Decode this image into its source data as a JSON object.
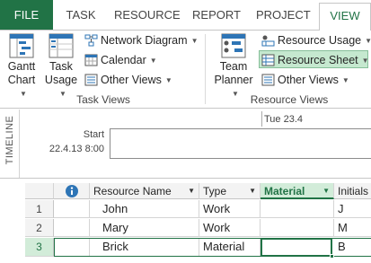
{
  "ribbon": {
    "tabs": {
      "file": "FILE",
      "task": "TASK",
      "resource": "RESOURCE",
      "report": "REPORT",
      "project": "PROJECT",
      "view": "VIEW"
    },
    "active_tab": "VIEW",
    "task_views": {
      "group_label": "Task Views",
      "gantt_chart": {
        "line1": "Gantt",
        "line2": "Chart",
        "icon": "gantt-chart-icon"
      },
      "task_usage": {
        "line1": "Task",
        "line2": "Usage",
        "icon": "task-usage-icon"
      },
      "network_diagram": {
        "label": "Network Diagram",
        "icon": "network-diagram-icon"
      },
      "calendar": {
        "label": "Calendar",
        "icon": "calendar-icon"
      },
      "other_views": {
        "label": "Other Views",
        "icon": "other-views-icon"
      }
    },
    "resource_views": {
      "group_label": "Resource Views",
      "team_planner": {
        "line1": "Team",
        "line2": "Planner",
        "icon": "team-planner-icon"
      },
      "resource_usage": {
        "label": "Resource Usage",
        "icon": "resource-usage-icon"
      },
      "resource_sheet": {
        "label": "Resource Sheet",
        "icon": "resource-sheet-icon",
        "selected": true
      },
      "other_views": {
        "label": "Other Views",
        "icon": "other-views-icon"
      }
    }
  },
  "timeline": {
    "side_label": "TIMELINE",
    "date_marker": "Tue 23.4",
    "start_label": "Start",
    "start_date": "22.4.13 8:00"
  },
  "grid": {
    "columns": [
      "Resource Name",
      "Type",
      "Material",
      "Initials"
    ],
    "info_icon": "info-icon",
    "active_column": "Material",
    "rows": [
      {
        "id": "1",
        "name": "John",
        "type": "Work",
        "material": "",
        "initials": "J"
      },
      {
        "id": "2",
        "name": "Mary",
        "type": "Work",
        "material": "",
        "initials": "M"
      },
      {
        "id": "3",
        "name": "Brick",
        "type": "Material",
        "material": "",
        "initials": "B"
      }
    ],
    "selected_row": "3"
  },
  "colors": {
    "accent": "#217346",
    "selected_fill": "#c5e8cf",
    "header_fill": "#f3f3f3"
  }
}
